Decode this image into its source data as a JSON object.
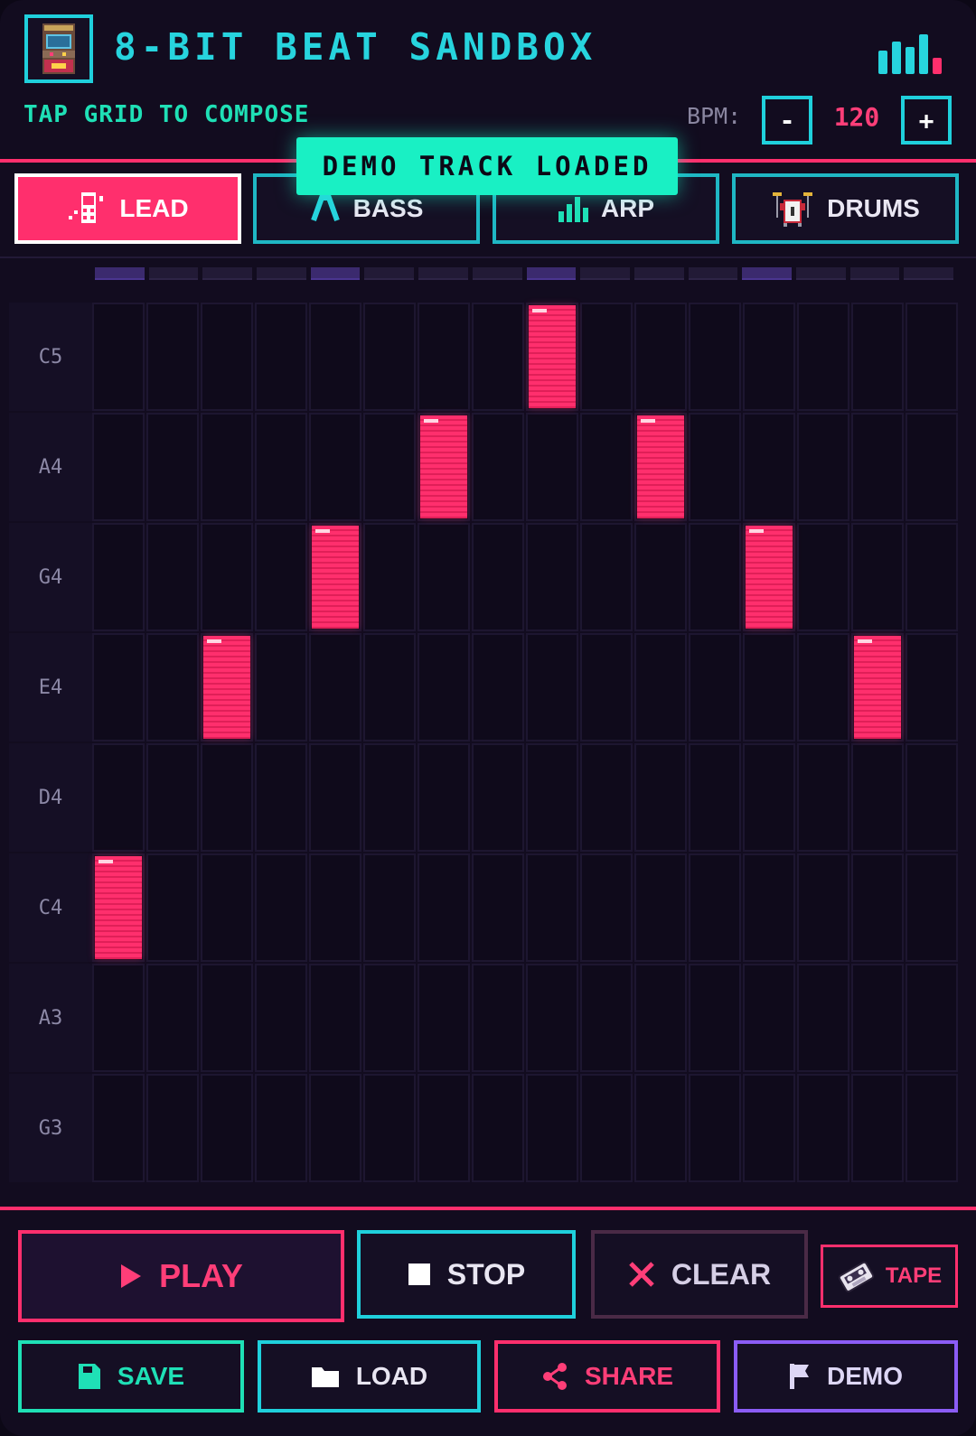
{
  "app": {
    "title": "8-BIT BEAT SANDBOX",
    "subtitle": "TAP GRID TO COMPOSE",
    "logo_icon": "arcade-cabinet-icon",
    "eq_icon": "equalizer-bars-icon"
  },
  "bpm": {
    "label": "BPM:",
    "value": "120",
    "decrement_label": "-",
    "increment_label": "+"
  },
  "toast": {
    "text": "DEMO TRACK LOADED"
  },
  "tabs": [
    {
      "label": "LEAD",
      "icon": "music-note-phone-icon",
      "active": true
    },
    {
      "label": "BASS",
      "icon": "bass-wave-icon",
      "active": false
    },
    {
      "label": "ARP",
      "icon": "arp-bars-icon",
      "active": false
    },
    {
      "label": "DRUMS",
      "icon": "drum-kit-icon",
      "active": false
    }
  ],
  "sequencer": {
    "steps": 16,
    "rows": [
      "C5",
      "A4",
      "G4",
      "E4",
      "D4",
      "C4",
      "A3",
      "G3"
    ],
    "active_notes": [
      {
        "row": "C4",
        "step": 1
      },
      {
        "row": "E4",
        "step": 3
      },
      {
        "row": "G4",
        "step": 5
      },
      {
        "row": "A4",
        "step": 7
      },
      {
        "row": "C5",
        "step": 9
      },
      {
        "row": "A4",
        "step": 11
      },
      {
        "row": "G4",
        "step": 13
      },
      {
        "row": "E4",
        "step": 15
      }
    ],
    "beat_steps": [
      1,
      5,
      9,
      13
    ]
  },
  "controls": {
    "play": {
      "label": "PLAY",
      "icon": "play-icon"
    },
    "stop": {
      "label": "STOP",
      "icon": "stop-icon"
    },
    "clear": {
      "label": "CLEAR",
      "icon": "close-icon"
    },
    "tape": {
      "label": "TAPE",
      "icon": "cassette-tape-icon"
    },
    "save": {
      "label": "SAVE",
      "icon": "save-icon"
    },
    "load": {
      "label": "LOAD",
      "icon": "folder-icon"
    },
    "share": {
      "label": "SHARE",
      "icon": "share-icon"
    },
    "demo": {
      "label": "DEMO",
      "icon": "flag-icon"
    }
  },
  "colors": {
    "accent_pink": "#ff2f6d",
    "accent_cyan": "#1fd0dc",
    "accent_mint": "#19f0c4",
    "accent_purple": "#8b5cf6",
    "background": "#120c1f"
  }
}
